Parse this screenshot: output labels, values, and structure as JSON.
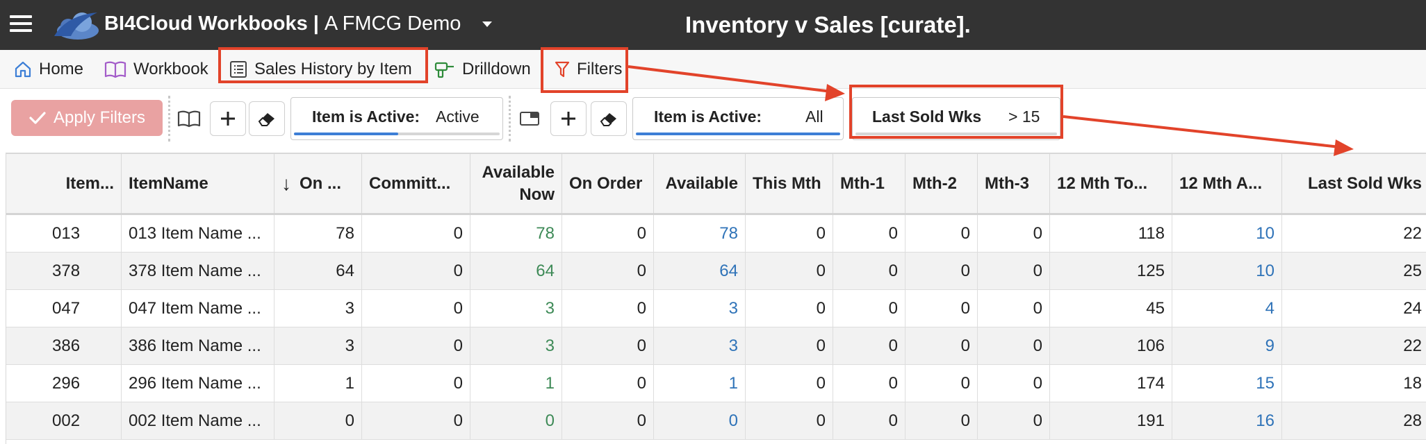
{
  "header": {
    "brand": "BI4Cloud Workbooks",
    "separator": "|",
    "workspace": "A FMCG Demo",
    "page_title": "Inventory v Sales [curate]."
  },
  "nav": {
    "items": [
      {
        "label": "Home",
        "icon": "home-icon"
      },
      {
        "label": "Workbook",
        "icon": "book-icon"
      },
      {
        "label": "Sales History by Item",
        "icon": "list-icon"
      },
      {
        "label": "Drilldown",
        "icon": "drill-icon"
      },
      {
        "label": "Filters",
        "icon": "filter-icon"
      }
    ]
  },
  "filterbar": {
    "apply_label": "Apply Filters",
    "filters": [
      {
        "label": "Item is Active:",
        "value": "Active"
      },
      {
        "label": "Item is Active:",
        "value": "All"
      },
      {
        "label": "Last Sold Wks",
        "value": "> 15"
      }
    ]
  },
  "colors": {
    "topbar": "#333333",
    "annotation_red": "#e2432a",
    "apply_button": "#e9a2a2",
    "accent_blue": "#3d7fd6",
    "value_green": "#3e8a57",
    "value_blue": "#2f73b8"
  },
  "table": {
    "columns": [
      {
        "label": "Item..."
      },
      {
        "label": "ItemName"
      },
      {
        "label": "On ...",
        "sort": "descending"
      },
      {
        "label": "Committ..."
      },
      {
        "label": "Available Now"
      },
      {
        "label": "On Order"
      },
      {
        "label": "Available"
      },
      {
        "label": "This Mth"
      },
      {
        "label": "Mth-1"
      },
      {
        "label": "Mth-2"
      },
      {
        "label": "Mth-3"
      },
      {
        "label": "12 Mth To..."
      },
      {
        "label": "12 Mth A..."
      },
      {
        "label": "Last Sold Wks"
      }
    ],
    "rows": [
      [
        "013",
        "013 Item Name ...",
        "78",
        "0",
        "78",
        "0",
        "78",
        "0",
        "0",
        "0",
        "0",
        "118",
        "10",
        "22"
      ],
      [
        "378",
        "378 Item Name ...",
        "64",
        "0",
        "64",
        "0",
        "64",
        "0",
        "0",
        "0",
        "0",
        "125",
        "10",
        "25"
      ],
      [
        "047",
        "047 Item Name ...",
        "3",
        "0",
        "3",
        "0",
        "3",
        "0",
        "0",
        "0",
        "0",
        "45",
        "4",
        "24"
      ],
      [
        "386",
        "386 Item Name ...",
        "3",
        "0",
        "3",
        "0",
        "3",
        "0",
        "0",
        "0",
        "0",
        "106",
        "9",
        "22"
      ],
      [
        "296",
        "296 Item Name ...",
        "1",
        "0",
        "1",
        "0",
        "1",
        "0",
        "0",
        "0",
        "0",
        "174",
        "15",
        "18"
      ],
      [
        "002",
        "002 Item Name ...",
        "0",
        "0",
        "0",
        "0",
        "0",
        "0",
        "0",
        "0",
        "0",
        "191",
        "16",
        "28"
      ]
    ]
  }
}
